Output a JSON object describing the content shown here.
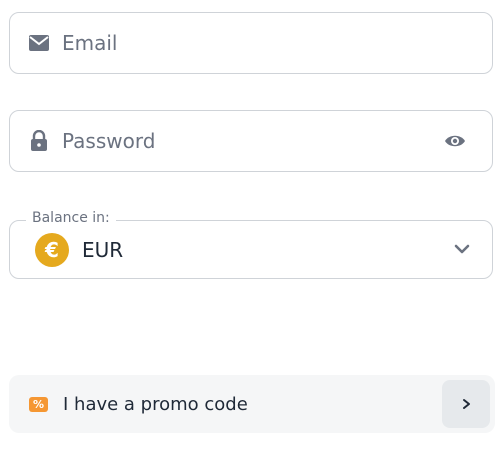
{
  "email": {
    "placeholder": "Email",
    "icon": "mail-icon"
  },
  "password": {
    "placeholder": "Password",
    "lead_icon": "lock-icon",
    "toggle_icon": "eye-icon"
  },
  "balance": {
    "label": "Balance in:",
    "selected": "EUR",
    "coin_symbol": "€",
    "coin_color": "#e5a91e",
    "dropdown_icon": "chevron-down-icon"
  },
  "promo": {
    "label": "I have a promo code",
    "badge_symbol": "%",
    "badge_color": "#f59733",
    "arrow_icon": "chevron-right-icon"
  }
}
